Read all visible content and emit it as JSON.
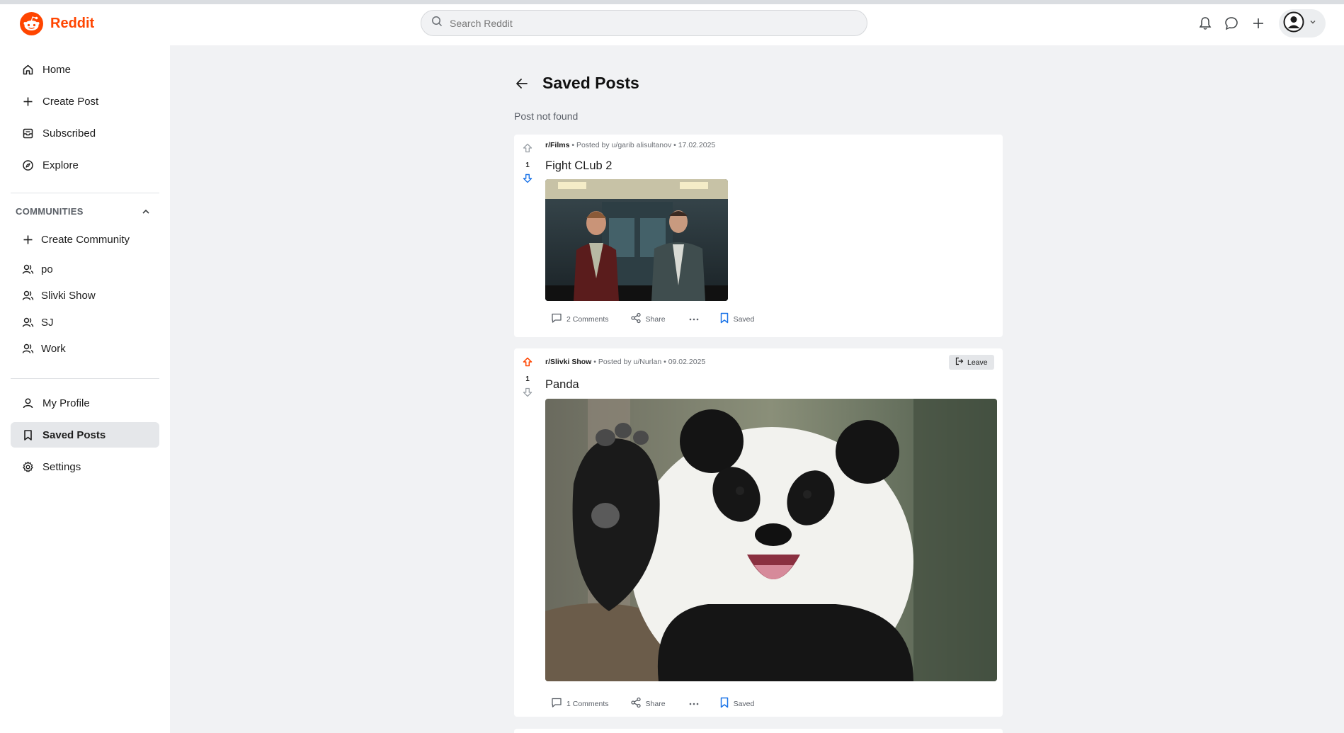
{
  "app": {
    "name": "Reddit",
    "brand_color": "#ff4500"
  },
  "search": {
    "placeholder": "Search Reddit"
  },
  "header_icons": [
    "bell-icon",
    "chat-icon",
    "plus-icon",
    "avatar-icon",
    "chevron-down-icon"
  ],
  "sidebar": {
    "main_items": [
      {
        "label": "Home",
        "icon": "home-icon"
      },
      {
        "label": "Create Post",
        "icon": "plus-icon"
      },
      {
        "label": "Subscribed",
        "icon": "inbox-icon"
      },
      {
        "label": "Explore",
        "icon": "compass-icon"
      }
    ],
    "communities_title": "COMMUNITIES",
    "communities": [
      {
        "label": "Create Community",
        "icon": "plus-icon"
      },
      {
        "label": "po",
        "icon": "users-icon"
      },
      {
        "label": "Slivki Show",
        "icon": "users-icon"
      },
      {
        "label": "SJ",
        "icon": "users-icon"
      },
      {
        "label": "Work",
        "icon": "users-icon"
      }
    ],
    "bottom_items": [
      {
        "label": "My Profile",
        "icon": "user-icon"
      },
      {
        "label": "Saved Posts",
        "icon": "bookmark-icon",
        "active": true
      },
      {
        "label": "Settings",
        "icon": "gear-icon"
      }
    ]
  },
  "page": {
    "title": "Saved Posts",
    "status": "Post not found"
  },
  "posts": [
    {
      "subreddit": "r/Films",
      "posted_by": "Posted by u/garib alisultanov",
      "date": "17.02.2025",
      "votes": "1",
      "vote_state": "down",
      "title": "Fight CLub 2",
      "comments": "2 Comments",
      "share": "Share",
      "saved": "Saved"
    },
    {
      "subreddit": "r/Slivki Show",
      "posted_by": "Posted by u/Nurlan",
      "date": "09.02.2025",
      "votes": "1",
      "vote_state": "up",
      "title": "Panda",
      "leave": "Leave",
      "comments": "1 Comments",
      "share": "Share",
      "saved": "Saved"
    }
  ]
}
